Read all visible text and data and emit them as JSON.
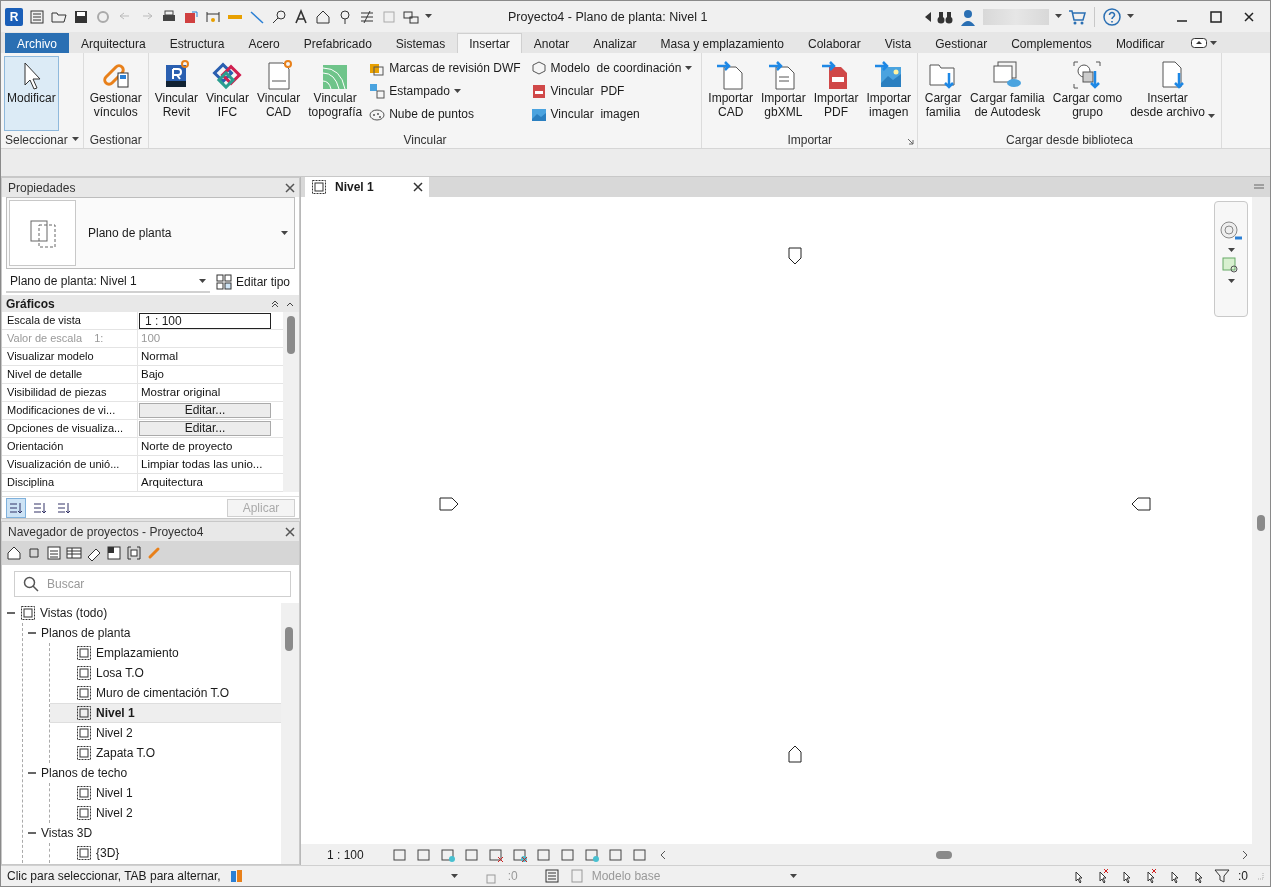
{
  "window": {
    "logo_letter": "R",
    "title": "Proyecto4 - Plano de planta: Nivel 1"
  },
  "menu_tabs": [
    {
      "label": "Archivo",
      "kind": "file",
      "selected": false
    },
    {
      "label": "Arquitectura",
      "kind": "tab",
      "selected": false
    },
    {
      "label": "Estructura",
      "kind": "tab",
      "selected": false
    },
    {
      "label": "Acero",
      "kind": "tab",
      "selected": false
    },
    {
      "label": "Prefabricado",
      "kind": "tab",
      "selected": false
    },
    {
      "label": "Sistemas",
      "kind": "tab",
      "selected": false
    },
    {
      "label": "Insertar",
      "kind": "tab",
      "selected": true
    },
    {
      "label": "Anotar",
      "kind": "tab",
      "selected": false
    },
    {
      "label": "Analizar",
      "kind": "tab",
      "selected": false
    },
    {
      "label": "Masa y emplazamiento",
      "kind": "tab",
      "selected": false
    },
    {
      "label": "Colaborar",
      "kind": "tab",
      "selected": false
    },
    {
      "label": "Vista",
      "kind": "tab",
      "selected": false
    },
    {
      "label": "Gestionar",
      "kind": "tab",
      "selected": false
    },
    {
      "label": "Complementos",
      "kind": "tab",
      "selected": false
    },
    {
      "label": "Modificar",
      "kind": "tab",
      "selected": false
    }
  ],
  "ribbon": {
    "panels": [
      {
        "title": "Seleccionar",
        "dropdown": true,
        "tools": [
          {
            "label": "Modificar",
            "selected": true
          }
        ]
      },
      {
        "title": "Gestionar",
        "tools": [
          {
            "label": "Gestionar\nvínculos",
            "selected": false
          }
        ]
      },
      {
        "title": "Vincular",
        "tools": [
          {
            "label": "Vincular\nRevit",
            "selected": false
          },
          {
            "label": "Vincular\nIFC",
            "selected": false
          },
          {
            "label": "Vincular\nCAD",
            "selected": false
          },
          {
            "label": "Vincular\ntopografía",
            "selected": false
          }
        ],
        "small_columns": [
          [
            {
              "label": "Marcas de revisión DWF"
            },
            {
              "label": "Estampado",
              "dropdown": true
            },
            {
              "label": "Nube de puntos"
            }
          ],
          [
            {
              "label": "Modelo  de coordinación",
              "dropdown": true
            },
            {
              "label": "Vincular  PDF"
            },
            {
              "label": "Vincular  imagen"
            }
          ]
        ]
      },
      {
        "title": "Importar",
        "launcher": true,
        "tools": [
          {
            "label": "Importar\nCAD",
            "selected": false
          },
          {
            "label": "Importar\ngbXML",
            "selected": false
          },
          {
            "label": "Importar\nPDF",
            "selected": false
          },
          {
            "label": "Importar\nimagen",
            "selected": false
          }
        ]
      },
      {
        "title": "Cargar desde biblioteca",
        "tools": [
          {
            "label": "Cargar\nfamilia",
            "selected": false
          },
          {
            "label": "Cargar familia\nde Autodesk",
            "selected": false
          },
          {
            "label": "Cargar como\ngrupo",
            "selected": false
          },
          {
            "label": "Insertar\ndesde archivo",
            "selected": false,
            "dropdown": true
          }
        ]
      }
    ]
  },
  "properties": {
    "title": "Propiedades",
    "type_name": "Plano de planta",
    "instance": "Plano de planta: Nivel 1",
    "edit_type": "Editar tipo",
    "group": "Gráficos",
    "rows": [
      {
        "name": "Escala de vista",
        "value": "1 : 100",
        "kind": "field"
      },
      {
        "name": "Valor de escala    1:",
        "value": "100",
        "kind": "readonly"
      },
      {
        "name": "Visualizar modelo",
        "value": "Normal",
        "kind": "text"
      },
      {
        "name": "Nivel de detalle",
        "value": "Bajo",
        "kind": "text"
      },
      {
        "name": "Visibilidad de piezas",
        "value": "Mostrar original",
        "kind": "text"
      },
      {
        "name": "Modificaciones de vi...",
        "value": "Editar...",
        "kind": "button"
      },
      {
        "name": "Opciones de visualiza...",
        "value": "Editar...",
        "kind": "button"
      },
      {
        "name": "Orientación",
        "value": "Norte de proyecto",
        "kind": "text"
      },
      {
        "name": "Visualización de unió...",
        "value": "Limpiar todas las unio...",
        "kind": "text"
      },
      {
        "name": "Disciplina",
        "value": "Arquitectura",
        "kind": "text"
      }
    ],
    "sort_buttons": [
      {
        "selected": true
      },
      {
        "selected": false
      },
      {
        "selected": false
      }
    ],
    "apply": {
      "label": "Aplicar",
      "disabled": true
    }
  },
  "browser": {
    "title": "Navegador de proyectos - Proyecto4",
    "search_placeholder": "Buscar",
    "tree": [
      {
        "label": "Vistas (todo)",
        "expanded": true,
        "selected": false,
        "children": [
          {
            "label": "Planos de planta",
            "expanded": true,
            "selected": false,
            "children": [
              {
                "label": "Emplazamiento",
                "selected": false
              },
              {
                "label": "Losa T.O",
                "selected": false
              },
              {
                "label": "Muro de cimentación T.O",
                "selected": false
              },
              {
                "label": "Nivel 1",
                "selected": true
              },
              {
                "label": "Nivel 2",
                "selected": false
              },
              {
                "label": "Zapata T.O",
                "selected": false
              }
            ]
          },
          {
            "label": "Planos de techo",
            "expanded": true,
            "selected": false,
            "children": [
              {
                "label": "Nivel 1",
                "selected": false
              },
              {
                "label": "Nivel 2",
                "selected": false
              }
            ]
          },
          {
            "label": "Vistas 3D",
            "expanded": true,
            "selected": false,
            "children": [
              {
                "label": "{3D}",
                "selected": false
              }
            ]
          }
        ]
      }
    ]
  },
  "view": {
    "tab": "Nivel 1",
    "scale": "1 : 100"
  },
  "status_bar": {
    "message": "Clic para seleccionar, TAB para alternar,",
    "workset_count": ":0",
    "design_option": "Modelo base",
    "filter_count": ":0"
  }
}
